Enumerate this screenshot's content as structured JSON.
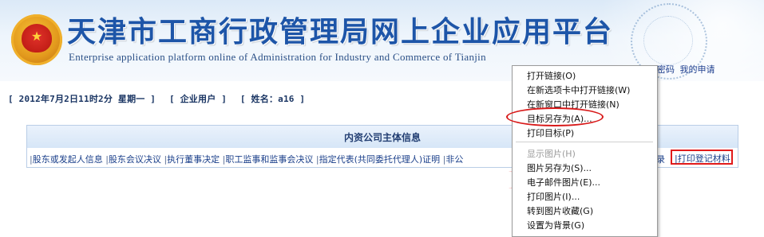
{
  "header": {
    "title_cn": "天津市工商行政管理局网上企业应用平台",
    "title_en": "Enterprise application platform online of Administration for Industry and Commerce of Tianjin",
    "links": [
      "密码",
      "我的申请"
    ]
  },
  "status": {
    "datetime": "[ 2012年7月2日11时2分 星期一 ]",
    "user_type": "[ 企业用户 ]",
    "user_name": "[ 姓名：a16 ]"
  },
  "panel": {
    "title": "内资公司主体信息",
    "tabs": [
      "股东或发起人信息",
      "股东会议决议",
      "执行董事决定",
      "职工监事和监事会决议",
      "指定代表(共同委托代理人)证明",
      "非公"
    ],
    "tab_partial": "录",
    "tab_highlighted": "打印登记材料"
  },
  "context_menu": {
    "items": [
      {
        "label": "打开链接(O)",
        "enabled": true
      },
      {
        "label": "在新选项卡中打开链接(W)",
        "enabled": true
      },
      {
        "label": "在新窗口中打开链接(N)",
        "enabled": true
      },
      {
        "label": "目标另存为(A)...",
        "enabled": true,
        "highlighted": true
      },
      {
        "label": "打印目标(P)",
        "enabled": true
      },
      {
        "label": "显示图片(H)",
        "enabled": false
      },
      {
        "label": "图片另存为(S)...",
        "enabled": true
      },
      {
        "label": "电子邮件图片(E)...",
        "enabled": true
      },
      {
        "label": "打印图片(I)...",
        "enabled": true
      },
      {
        "label": "转到图片收藏(G)",
        "enabled": true
      },
      {
        "label": "设置为背景(G)",
        "enabled": true
      }
    ]
  },
  "colors": {
    "title_blue": "#1d55a8",
    "link_blue": "#1a3f8a",
    "highlight_red": "#e11b1b"
  }
}
